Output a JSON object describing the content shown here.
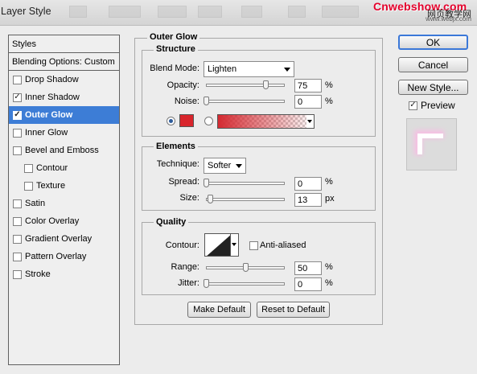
{
  "window": {
    "title": "Layer Style"
  },
  "watermark": {
    "brand": "Cnwebshow.com",
    "cn": "网页教学网",
    "url": "www.webjx.com"
  },
  "styles": {
    "header": "Styles",
    "blending_options": "Blending Options: Custom",
    "items": [
      {
        "label": "Drop Shadow",
        "checked": false,
        "check": ""
      },
      {
        "label": "Inner Shadow",
        "checked": true,
        "check": "✓"
      },
      {
        "label": "Outer Glow",
        "checked": true,
        "check": "✓",
        "selected": true
      },
      {
        "label": "Inner Glow",
        "checked": false,
        "check": ""
      },
      {
        "label": "Bevel and Emboss",
        "checked": false,
        "check": ""
      },
      {
        "label": "Contour",
        "checked": false,
        "check": "",
        "sub": true
      },
      {
        "label": "Texture",
        "checked": false,
        "check": "",
        "sub": true
      },
      {
        "label": "Satin",
        "checked": false,
        "check": ""
      },
      {
        "label": "Color Overlay",
        "checked": false,
        "check": ""
      },
      {
        "label": "Gradient Overlay",
        "checked": false,
        "check": ""
      },
      {
        "label": "Pattern Overlay",
        "checked": false,
        "check": ""
      },
      {
        "label": "Stroke",
        "checked": false,
        "check": ""
      }
    ]
  },
  "outer_glow": {
    "title": "Outer Glow",
    "structure": {
      "title": "Structure",
      "blend_mode_label": "Blend Mode:",
      "blend_mode_value": "Lighten",
      "opacity_label": "Opacity:",
      "opacity_value": "75",
      "opacity_unit": "%",
      "opacity_fraction": 0.75,
      "noise_label": "Noise:",
      "noise_value": "0",
      "noise_unit": "%",
      "noise_fraction": 0,
      "glow_color": "#d8252c",
      "color_mode": "solid"
    },
    "elements": {
      "title": "Elements",
      "technique_label": "Technique:",
      "technique_value": "Softer",
      "spread_label": "Spread:",
      "spread_value": "0",
      "spread_unit": "%",
      "spread_fraction": 0,
      "size_label": "Size:",
      "size_value": "13",
      "size_unit": "px",
      "size_fraction": 0.052
    },
    "quality": {
      "title": "Quality",
      "contour_label": "Contour:",
      "anti_aliased_label": "Anti-aliased",
      "anti_aliased": false,
      "range_label": "Range:",
      "range_value": "50",
      "range_unit": "%",
      "range_fraction": 0.5,
      "jitter_label": "Jitter:",
      "jitter_value": "0",
      "jitter_unit": "%",
      "jitter_fraction": 0
    },
    "make_default": "Make Default",
    "reset_default": "Reset to Default"
  },
  "actions": {
    "ok": "OK",
    "cancel": "Cancel",
    "new_style": "New Style...",
    "preview_label": "Preview",
    "preview_check": "✓",
    "preview_checked": true
  }
}
